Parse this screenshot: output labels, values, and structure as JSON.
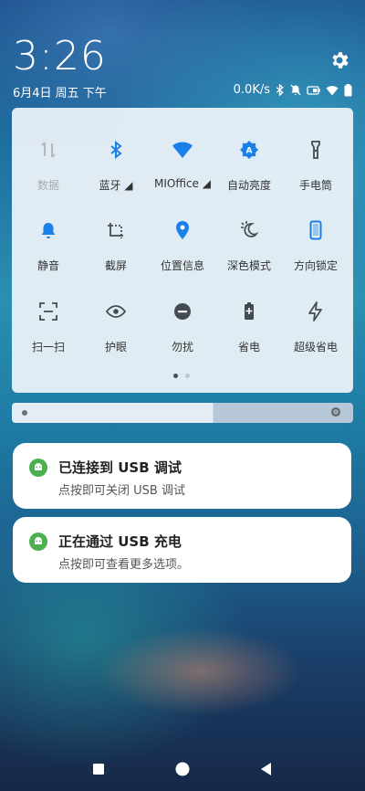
{
  "status_bar": {
    "time": "3:26",
    "date": "6月4日 周五 下午",
    "network_speed": "0.0K/s",
    "icons": [
      "bluetooth-icon",
      "mute-icon",
      "battery-saver-icon",
      "wifi-icon",
      "battery-icon"
    ]
  },
  "quick_settings": {
    "tiles": [
      {
        "label": "数据",
        "icon": "mobile-data-icon",
        "state": "disabled"
      },
      {
        "label": "蓝牙 ◢",
        "icon": "bluetooth-icon",
        "state": "on"
      },
      {
        "label": "MIOffice ◢",
        "icon": "wifi-icon",
        "state": "on"
      },
      {
        "label": "自动亮度",
        "icon": "auto-brightness-icon",
        "state": "on"
      },
      {
        "label": "手电筒",
        "icon": "flashlight-icon",
        "state": "off"
      },
      {
        "label": "静音",
        "icon": "bell-icon",
        "state": "on"
      },
      {
        "label": "截屏",
        "icon": "screenshot-icon",
        "state": "off"
      },
      {
        "label": "位置信息",
        "icon": "location-icon",
        "state": "on"
      },
      {
        "label": "深色模式",
        "icon": "dark-mode-icon",
        "state": "off"
      },
      {
        "label": "方向锁定",
        "icon": "rotation-lock-icon",
        "state": "on"
      },
      {
        "label": "扫一扫",
        "icon": "scan-icon",
        "state": "off"
      },
      {
        "label": "护眼",
        "icon": "eye-icon",
        "state": "off"
      },
      {
        "label": "勿扰",
        "icon": "dnd-icon",
        "state": "off"
      },
      {
        "label": "省电",
        "icon": "battery-saver-icon",
        "state": "off"
      },
      {
        "label": "超级省电",
        "icon": "ultra-saver-icon",
        "state": "off"
      }
    ],
    "page_indicator": {
      "current": 1,
      "total": 2
    }
  },
  "brightness": {
    "level": 0.59
  },
  "notifications": [
    {
      "title": "已连接到 USB 调试",
      "body": "点按即可关闭 USB 调试"
    },
    {
      "title": "正在通过 USB 充电",
      "body": "点按即可查看更多选项。"
    }
  ],
  "colors": {
    "accent": "#1a7fe8",
    "icon_gray": "#444a52",
    "disabled": "#a9adb3",
    "android_green": "#4caf50"
  }
}
